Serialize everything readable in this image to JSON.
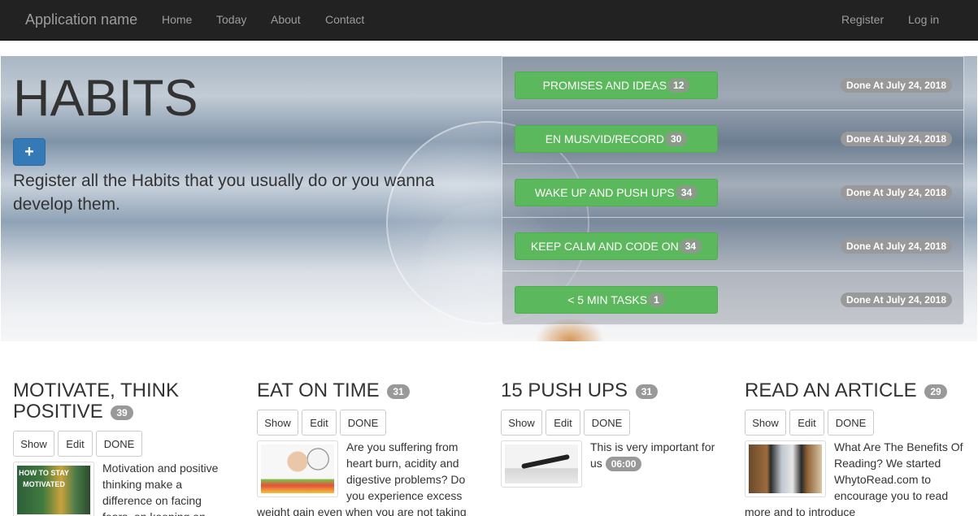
{
  "navbar": {
    "brand": "Application name",
    "links": [
      "Home",
      "Today",
      "About",
      "Contact"
    ],
    "right_links": [
      "Register",
      "Log in"
    ]
  },
  "hero": {
    "title": "HABITS",
    "add_button": "+",
    "lead": "Register all the Habits that you usually do or you wanna develop them."
  },
  "habits": [
    {
      "name": "PROMISES AND IDEAS",
      "count": "12",
      "done": "Done At July 24, 2018"
    },
    {
      "name": "EN MUS/VID/RECORD",
      "count": "30",
      "done": "Done At July 24, 2018"
    },
    {
      "name": "WAKE UP AND PUSH UPS",
      "count": "34",
      "done": "Done At July 24, 2018"
    },
    {
      "name": "KEEP CALM AND CODE ON",
      "count": "34",
      "done": "Done At July 24, 2018"
    },
    {
      "name": "< 5 MIN TASKS",
      "count": "1",
      "done": "Done At July 24, 2018"
    }
  ],
  "cards": [
    {
      "title": "MOTIVATE, THINK POSITIVE",
      "count": "39",
      "show": "Show",
      "edit": "Edit",
      "done": "DONE",
      "text": "Motivation and positive thinking make a difference on facing fears, on keeping on",
      "thumb_text": "HOW TO STAY MOTIVATED"
    },
    {
      "title": "EAT ON TIME",
      "count": "31",
      "show": "Show",
      "edit": "Edit",
      "done": "DONE",
      "text": "Are you suffering from heart burn, acidity and digestive problems? Do you experience excess weight gain even when you are not taking"
    },
    {
      "title": "15 PUSH UPS",
      "count": "31",
      "show": "Show",
      "edit": "Edit",
      "done": "DONE",
      "text": "This is very important for us",
      "time": "06:00"
    },
    {
      "title": "READ AN ARTICLE",
      "count": "29",
      "show": "Show",
      "edit": "Edit",
      "done": "DONE",
      "text": "What Are The Benefits Of Reading? We started WhytoRead.com to encourage you to read more and to introduce"
    }
  ],
  "colors": {
    "navbar": "#222222",
    "primary": "#337ab7",
    "success": "#5cb85c",
    "badge": "#999999"
  }
}
